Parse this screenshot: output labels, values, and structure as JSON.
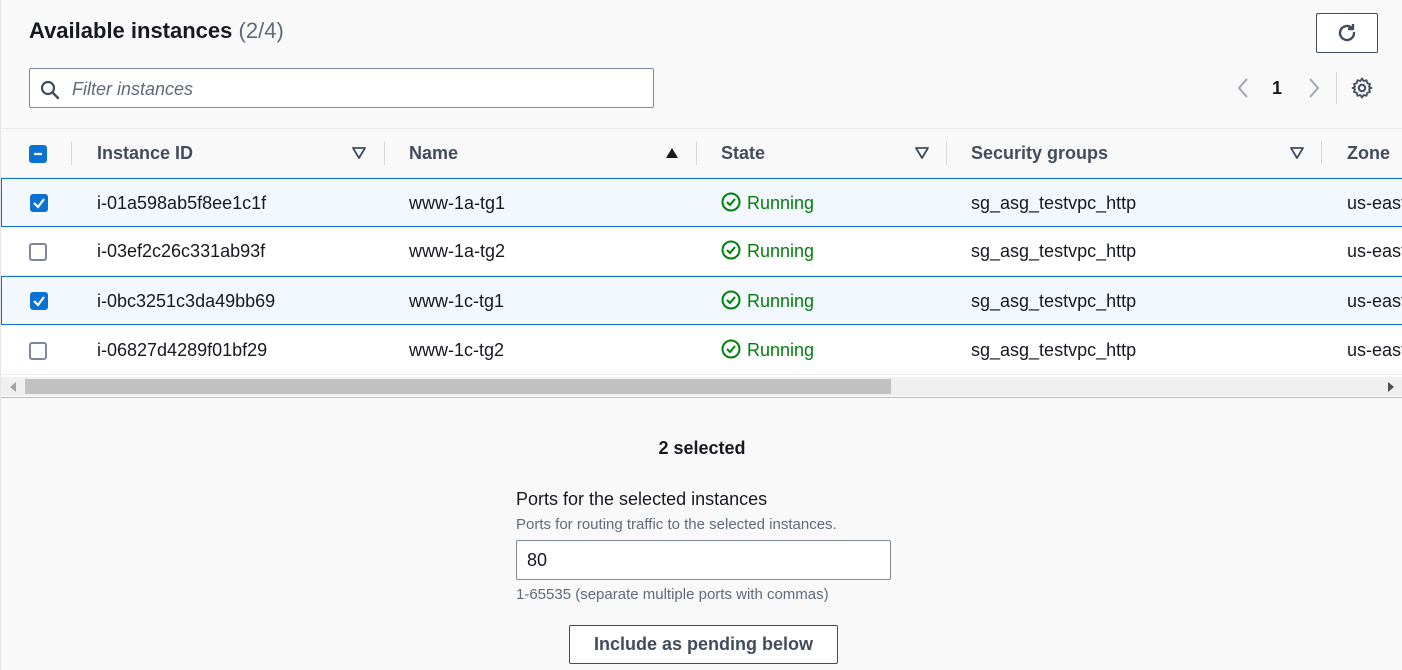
{
  "header": {
    "title": "Available instances",
    "count": "(2/4)",
    "refresh_icon": "refresh-icon"
  },
  "search": {
    "placeholder": "Filter instances",
    "value": "",
    "icon": "search-icon"
  },
  "pagination": {
    "current_page": "1",
    "prev_icon": "chevron-left-icon",
    "next_icon": "chevron-right-icon",
    "settings_icon": "gear-icon"
  },
  "table": {
    "select_all_state": "indeterminate",
    "columns": [
      {
        "label": "Instance ID",
        "sort": "none"
      },
      {
        "label": "Name",
        "sort": "ascending"
      },
      {
        "label": "State",
        "sort": "none"
      },
      {
        "label": "Security groups",
        "sort": "none"
      },
      {
        "label": "Zone",
        "sort": "none"
      }
    ],
    "rows": [
      {
        "selected": true,
        "id": "i-01a598ab5f8ee1c1f",
        "name": "www-1a-tg1",
        "state": "Running",
        "sg": "sg_asg_testvpc_http",
        "zone": "us-east"
      },
      {
        "selected": false,
        "id": "i-03ef2c26c331ab93f",
        "name": "www-1a-tg2",
        "state": "Running",
        "sg": "sg_asg_testvpc_http",
        "zone": "us-east"
      },
      {
        "selected": true,
        "id": "i-0bc3251c3da49bb69",
        "name": "www-1c-tg1",
        "state": "Running",
        "sg": "sg_asg_testvpc_http",
        "zone": "us-east"
      },
      {
        "selected": false,
        "id": "i-06827d4289f01bf29",
        "name": "www-1c-tg2",
        "state": "Running",
        "sg": "sg_asg_testvpc_http",
        "zone": "us-east"
      }
    ]
  },
  "selection": {
    "count_text": "2 selected"
  },
  "ports": {
    "label": "Ports for the selected instances",
    "description": "Ports for routing traffic to the selected instances.",
    "value": "80",
    "hint": "1-65535 (separate multiple ports with commas)"
  },
  "actions": {
    "include_label": "Include as pending below"
  },
  "colors": {
    "accent": "#0972d3",
    "success": "#037f0c",
    "text": "#16191f",
    "muted": "#5f6b7a"
  }
}
